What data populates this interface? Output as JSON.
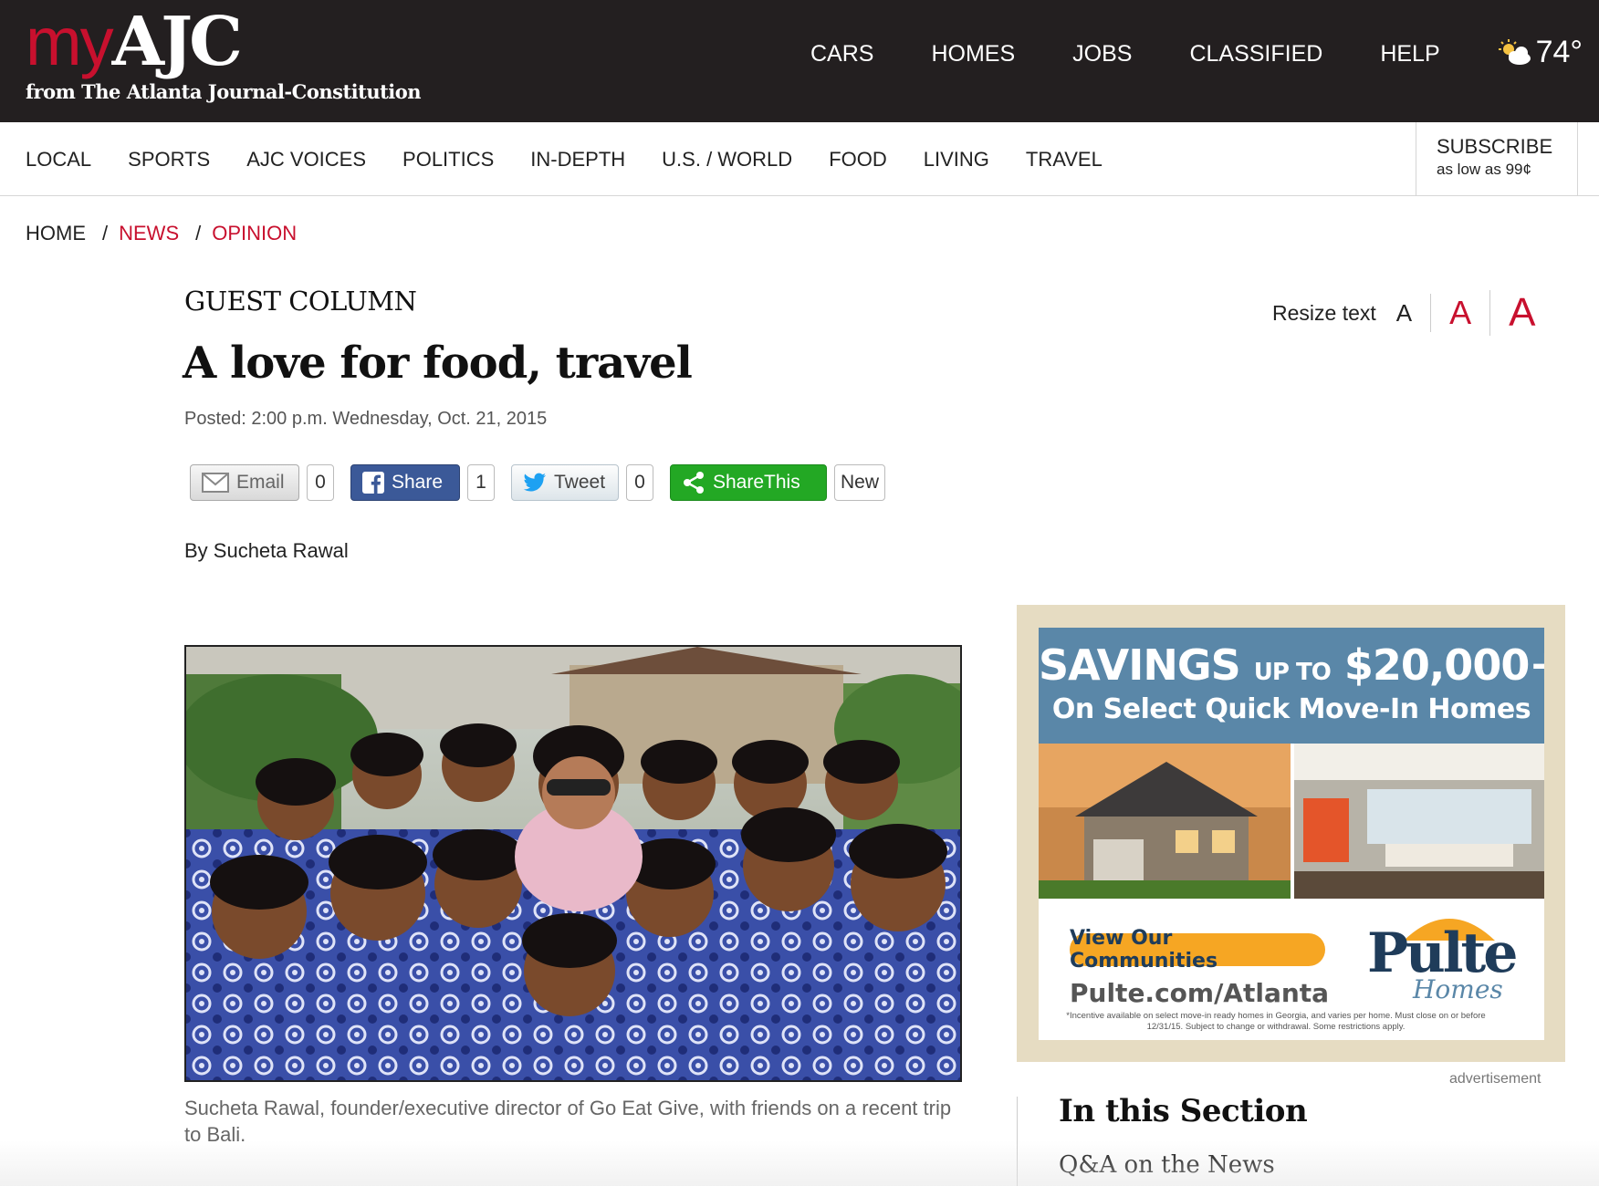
{
  "header": {
    "logo_my": "my",
    "logo_ajc": "AJC",
    "logo_sub": "from The Atlanta Journal-Constitution",
    "nav": [
      "CARS",
      "HOMES",
      "JOBS",
      "CLASSIFIED",
      "HELP"
    ],
    "weather_temp": "74°",
    "weather_icon": "partly-cloudy-icon"
  },
  "section_nav": {
    "items": [
      "LOCAL",
      "SPORTS",
      "AJC VOICES",
      "POLITICS",
      "IN-DEPTH",
      "U.S. / WORLD",
      "FOOD",
      "LIVING",
      "TRAVEL"
    ],
    "subscribe_label": "SUBSCRIBE",
    "subscribe_sub": "as low as 99¢"
  },
  "breadcrumb": {
    "home": "HOME",
    "sep": "/",
    "news": "NEWS",
    "opinion": "OPINION"
  },
  "article": {
    "kicker": "GUEST COLUMN",
    "headline": "A love for food, travel",
    "posted": "Posted: 2:00 p.m. Wednesday, Oct. 21, 2015",
    "byline": "By Sucheta Rawal",
    "caption": "Sucheta Rawal, founder/executive director of Go Eat Give, with friends on a recent trip to Bali."
  },
  "resize": {
    "label": "Resize text",
    "small": "A",
    "medium": "A",
    "large": "A"
  },
  "share": {
    "email_label": "Email",
    "email_count": "0",
    "facebook_label": "Share",
    "facebook_count": "1",
    "twitter_label": "Tweet",
    "twitter_count": "0",
    "sharethis_label": "ShareThis",
    "sharethis_badge": "New"
  },
  "ad": {
    "headline_big": "SAVINGS",
    "headline_small": "UP TO",
    "headline_amount": "$20,000+",
    "subheadline": "On Select Quick Move-In Homes",
    "cta": "View Our Communities",
    "url": "Pulte.com/Atlanta",
    "brand": "Pulte",
    "brand_sub": "Homes",
    "fine_print": "*Incentive available on select move-in ready homes in Georgia, and varies per home. Must close on or before 12/31/15. Subject to change or withdrawal. Some restrictions apply.",
    "label": "advertisement"
  },
  "sidebar": {
    "title": "In this Section",
    "first_item": "Q&A on the News"
  },
  "colors": {
    "brand_red": "#c8102e",
    "header_bg": "#231f20",
    "facebook": "#3b5998",
    "sharethis": "#23a824",
    "ad_blue": "#5a87a8"
  }
}
